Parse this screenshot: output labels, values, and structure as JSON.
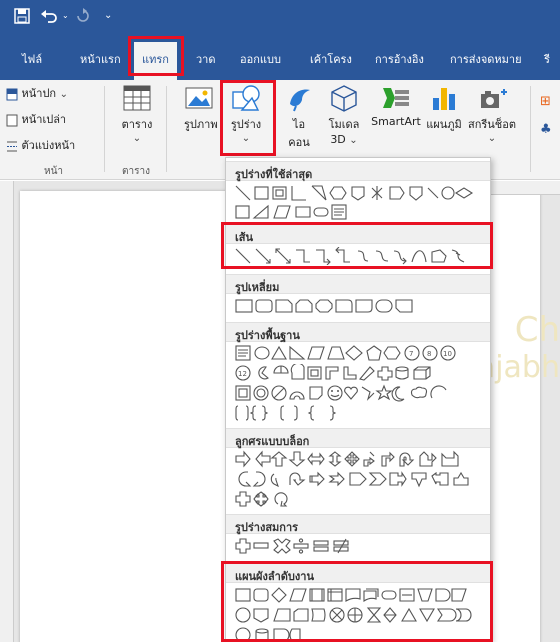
{
  "qat": {
    "save_icon": "save-icon",
    "undo_icon": "undo-icon",
    "redo_icon": "redo-icon",
    "more_icon": "customize-qat-icon"
  },
  "tabs": [
    {
      "label": "ไฟล์"
    },
    {
      "label": "หน้าแรก"
    },
    {
      "label": "แทรก"
    },
    {
      "label": "วาด"
    },
    {
      "label": "ออกแบบ"
    },
    {
      "label": "เค้าโครง"
    },
    {
      "label": "การอ้างอิง"
    },
    {
      "label": "การส่งจดหมาย"
    },
    {
      "label": "รี"
    }
  ],
  "ribbon": {
    "pages": {
      "cover": "หน้าปก",
      "blank": "หน้าเปล่า",
      "break": "ตัวแบ่งหน้า",
      "group": "หน้า"
    },
    "table": {
      "label": "ตาราง",
      "group": "ตาราง"
    },
    "picture": "รูปภาพ",
    "shapes": "รูปร่าง",
    "icons_line1": "ไอ",
    "icons_line2": "คอน",
    "model_line1": "โมเดล",
    "model_line2": "3D",
    "smartart": "SmartArt",
    "chart": "แผนภูมิ",
    "screenshot": "สกรีนช็อต"
  },
  "gallery": {
    "sections": [
      {
        "label": "รูปร่างที่ใช้ล่าสุด"
      },
      {
        "label": "เส้น"
      },
      {
        "label": "รูปเหลี่ยม"
      },
      {
        "label": "รูปร่างพื้นฐาน"
      },
      {
        "label": "ลูกศรแบบบล็อก"
      },
      {
        "label": "รูปร่างสมการ"
      },
      {
        "label": "แผนผังลำดับงาน"
      }
    ]
  },
  "watermark": {
    "line1": "Ch",
    "line2": "ajabh"
  }
}
